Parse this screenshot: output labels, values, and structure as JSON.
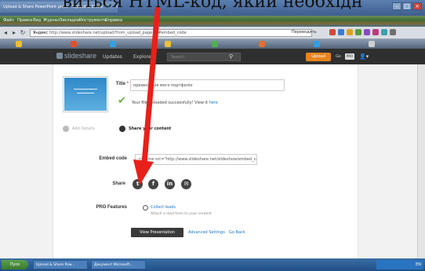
{
  "caption": "виться HTML-код, який необхідн",
  "browser": {
    "tabs": [
      "Upload & Share PowerPoint presentations, documents, infographics",
      "Upload & Share"
    ],
    "menus": [
      "Файл",
      "Правка",
      "Вид",
      "Журнал",
      "Закладки",
      "Инструменты",
      "Справка"
    ],
    "url_prefix": "Яндекс",
    "url": "http://www.slideshare.net/upload?from_upload_page=1#embed_code",
    "translate": "Переводить"
  },
  "header": {
    "logo": "slideshare",
    "nav": [
      "Updates",
      "Explore"
    ],
    "search_placeholder": "Search",
    "upload": "Upload",
    "go": "Go",
    "pro": "PRO"
  },
  "form": {
    "title_label": "Title",
    "title_required": "*",
    "title_value": "презентація мого портфоліо",
    "success_prefix": "Your file uploaded successfully! View it",
    "success_link": "here",
    "step1": "Add Details",
    "step2": "Share your content",
    "embed_label": "Embed code",
    "embed_value": "<iframe src=\"http://www.slideshare.net/slideshow/embed_code",
    "share_label": "Share",
    "pro_label": "PRO Features",
    "collect_leads": "Collect leads",
    "attach_form": "Attach a lead form to your content",
    "view_button": "View Presentation",
    "advanced": "Advanced Settings",
    "go_back": "Go Back"
  },
  "taskbar": {
    "start": "Пуск",
    "tasks": [
      "Upload & Share Pow...",
      "Документ Microsoft..."
    ],
    "clock": "EN"
  },
  "colors": {
    "accent": "#1b74c3",
    "upload": "#e7841f",
    "check": "#6ab04c",
    "annotation": "#e8201a"
  }
}
